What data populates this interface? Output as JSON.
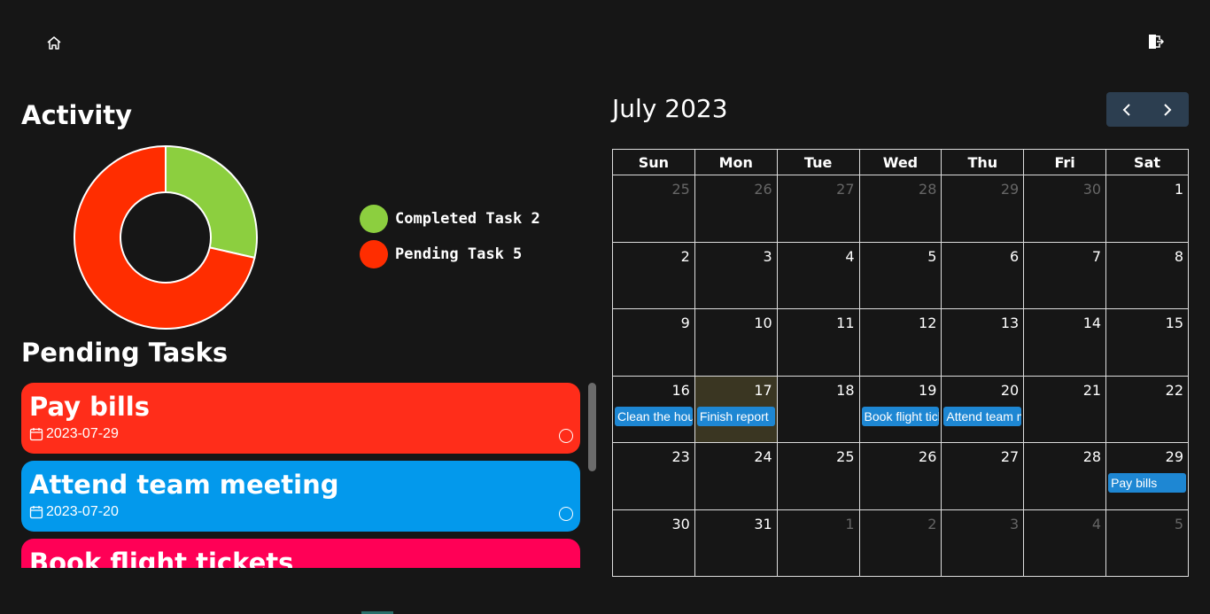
{
  "topbar": {
    "home_icon": "home-icon",
    "logout_icon": "logout-icon"
  },
  "activity": {
    "title": "Activity",
    "legend": [
      {
        "label": "Completed Task 2",
        "color": "#8ccf3f"
      },
      {
        "label": "Pending Task 5",
        "color": "#ff2d00"
      }
    ]
  },
  "chart_data": {
    "type": "pie",
    "categories": [
      "Completed Task",
      "Pending Task"
    ],
    "values": [
      2,
      5
    ],
    "colors": [
      "#8ccf3f",
      "#ff2d00"
    ]
  },
  "pending": {
    "title": "Pending Tasks",
    "tasks": [
      {
        "name": "Pay bills",
        "date": "2023-07-29",
        "color": "#ff2d1a"
      },
      {
        "name": "Attend team meeting",
        "date": "2023-07-20",
        "color": "#0399ec"
      },
      {
        "name": "Book flight tickets",
        "date": "",
        "color": "#ff0056"
      }
    ]
  },
  "calendar": {
    "title": "July 2023",
    "prev_icon": "chevron-left-icon",
    "next_icon": "chevron-right-icon",
    "weekdays": [
      "Sun",
      "Mon",
      "Tue",
      "Wed",
      "Thu",
      "Fri",
      "Sat"
    ],
    "weeks": [
      [
        "25",
        "26",
        "27",
        "28",
        "29",
        "30",
        "1"
      ],
      [
        "2",
        "3",
        "4",
        "5",
        "6",
        "7",
        "8"
      ],
      [
        "9",
        "10",
        "11",
        "12",
        "13",
        "14",
        "15"
      ],
      [
        "16",
        "17",
        "18",
        "19",
        "20",
        "21",
        "22"
      ],
      [
        "23",
        "24",
        "25",
        "26",
        "27",
        "28",
        "29"
      ],
      [
        "30",
        "31",
        "1",
        "2",
        "3",
        "4",
        "5"
      ]
    ],
    "events": {
      "3-0": "Clean the house",
      "3-1": "Finish report",
      "3-3": "Book flight tickets",
      "3-4": "Attend team meeting",
      "4-6": "Pay bills"
    }
  }
}
